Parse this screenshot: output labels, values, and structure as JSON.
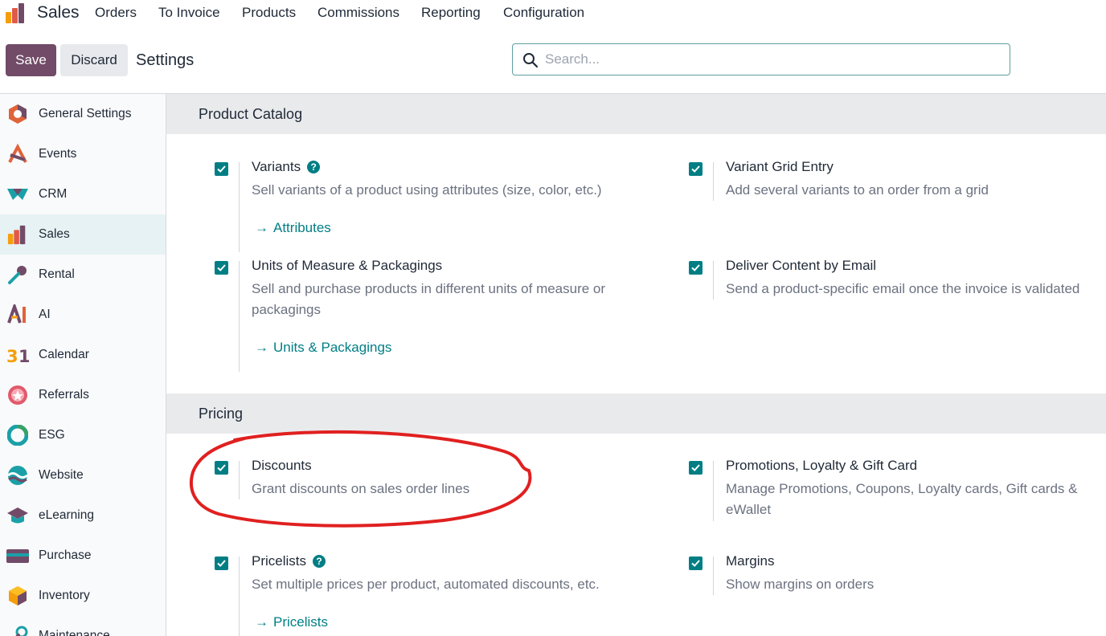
{
  "app": {
    "name": "Sales",
    "menu": [
      "Orders",
      "To Invoice",
      "Products",
      "Commissions",
      "Reporting",
      "Configuration"
    ]
  },
  "controls": {
    "save_label": "Save",
    "discard_label": "Discard",
    "page_title": "Settings",
    "search_placeholder": "Search..."
  },
  "sidebar": {
    "items": [
      {
        "label": "General Settings",
        "icon": "general-settings-icon",
        "active": false
      },
      {
        "label": "Events",
        "icon": "events-icon",
        "active": false
      },
      {
        "label": "CRM",
        "icon": "crm-icon",
        "active": false
      },
      {
        "label": "Sales",
        "icon": "sales-icon",
        "active": true
      },
      {
        "label": "Rental",
        "icon": "rental-icon",
        "active": false
      },
      {
        "label": "AI",
        "icon": "ai-icon",
        "active": false
      },
      {
        "label": "Calendar",
        "icon": "calendar-icon",
        "active": false
      },
      {
        "label": "Referrals",
        "icon": "referrals-icon",
        "active": false
      },
      {
        "label": "ESG",
        "icon": "esg-icon",
        "active": false
      },
      {
        "label": "Website",
        "icon": "website-icon",
        "active": false
      },
      {
        "label": "eLearning",
        "icon": "elearning-icon",
        "active": false
      },
      {
        "label": "Purchase",
        "icon": "purchase-icon",
        "active": false
      },
      {
        "label": "Inventory",
        "icon": "inventory-icon",
        "active": false
      },
      {
        "label": "Maintenance",
        "icon": "maintenance-icon",
        "active": false
      }
    ]
  },
  "sections": {
    "catalog": {
      "title": "Product Catalog",
      "variants": {
        "title": "Variants",
        "desc": "Sell variants of a product using attributes (size, color, etc.)",
        "link": "Attributes",
        "checked": true
      },
      "grid_entry": {
        "title": "Variant Grid Entry",
        "desc": "Add several variants to an order from a grid",
        "checked": true
      },
      "uom": {
        "title": "Units of Measure & Packagings",
        "desc": "Sell and purchase products in different units of measure or packagings",
        "link": "Units & Packagings",
        "checked": true
      },
      "email": {
        "title": "Deliver Content by Email",
        "desc": "Send a product-specific email once the invoice is validated",
        "checked": true
      }
    },
    "pricing": {
      "title": "Pricing",
      "discounts": {
        "title": "Discounts",
        "desc": "Grant discounts on sales order lines",
        "checked": true
      },
      "promotions": {
        "title": "Promotions, Loyalty & Gift Card",
        "desc": "Manage Promotions, Coupons, Loyalty cards, Gift cards & eWallet",
        "checked": true
      },
      "pricelists": {
        "title": "Pricelists",
        "desc": "Set multiple prices per product, automated discounts, etc.",
        "link": "Pricelists",
        "checked": true
      },
      "margins": {
        "title": "Margins",
        "desc": "Show margins on orders",
        "checked": true
      }
    }
  },
  "colors": {
    "brand": "#714b67",
    "accent": "#017e84",
    "annotation": "#e02020"
  }
}
